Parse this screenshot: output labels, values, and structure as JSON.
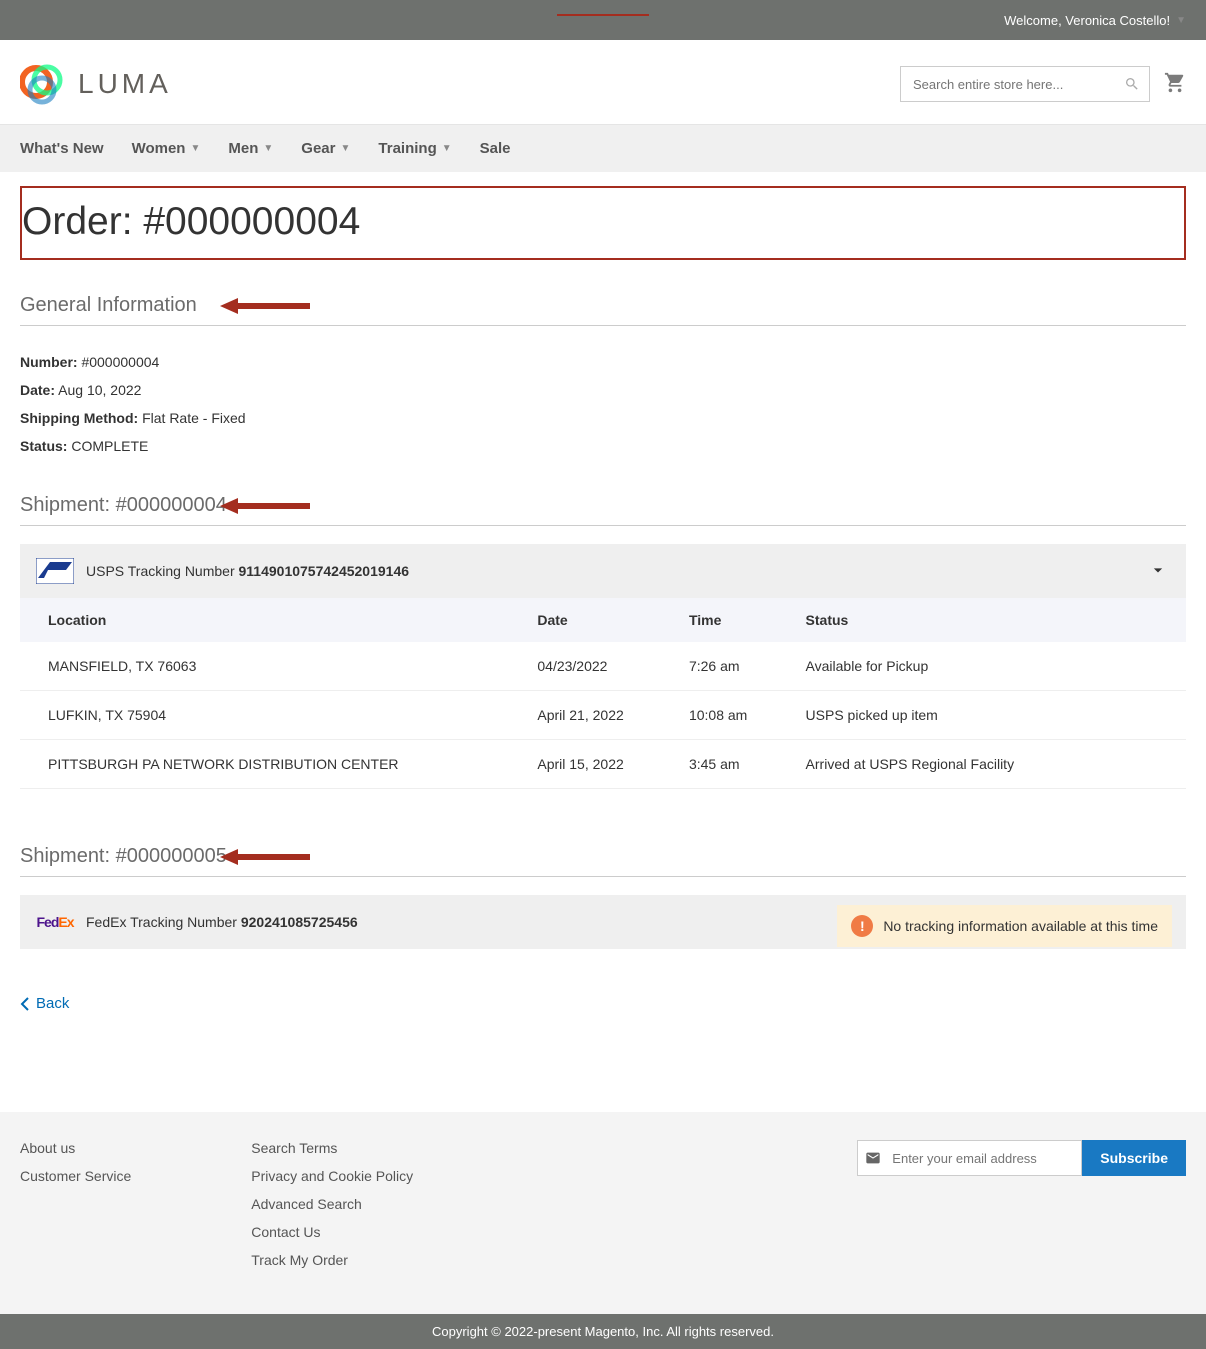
{
  "topbar": {
    "welcome": "Welcome, Veronica Costello!"
  },
  "header": {
    "logo_text": "LUMA",
    "search_placeholder": "Search entire store here..."
  },
  "nav": {
    "whats_new": "What's New",
    "women": "Women",
    "men": "Men",
    "gear": "Gear",
    "training": "Training",
    "sale": "Sale"
  },
  "page_title": "Order: #000000004",
  "general": {
    "heading": "General Information",
    "number_label": "Number:",
    "number_value": "#000000004",
    "date_label": "Date:",
    "date_value": "Aug 10, 2022",
    "shipping_label": "Shipping Method:",
    "shipping_value": "Flat Rate - Fixed",
    "status_label": "Status:",
    "status_value": "COMPLETE"
  },
  "shipment1": {
    "heading": "Shipment: #000000004",
    "carrier": "USPS",
    "track_label": "USPS Tracking Number ",
    "track_number": "9114901075742452019146",
    "columns": {
      "location": "Location",
      "date": "Date",
      "time": "Time",
      "status": "Status"
    },
    "rows": [
      {
        "location": "MANSFIELD, TX 76063",
        "date": "04/23/2022",
        "time": "7:26 am",
        "status": "Available for Pickup"
      },
      {
        "location": "LUFKIN, TX 75904",
        "date": "April 21, 2022",
        "time": "10:08 am",
        "status": "USPS picked up item"
      },
      {
        "location": "PITTSBURGH PA NETWORK DISTRIBUTION CENTER",
        "date": "April 15, 2022",
        "time": "3:45 am",
        "status": "Arrived at USPS Regional Facility"
      }
    ]
  },
  "shipment2": {
    "heading": "Shipment: #000000005",
    "carrier": "FedEx",
    "track_label": "FedEx Tracking Number ",
    "track_number": "920241085725456",
    "no_track_msg": "No tracking information available at this time"
  },
  "back": "Back",
  "footer": {
    "col1": {
      "about": "About us",
      "customer_service": "Customer Service"
    },
    "col2": {
      "search_terms": "Search Terms",
      "privacy": "Privacy and Cookie Policy",
      "advanced": "Advanced Search",
      "contact": "Contact Us",
      "track": "Track My Order"
    },
    "newsletter_placeholder": "Enter your email address",
    "subscribe": "Subscribe"
  },
  "copyright": "Copyright © 2022-present Magento, Inc. All rights reserved."
}
